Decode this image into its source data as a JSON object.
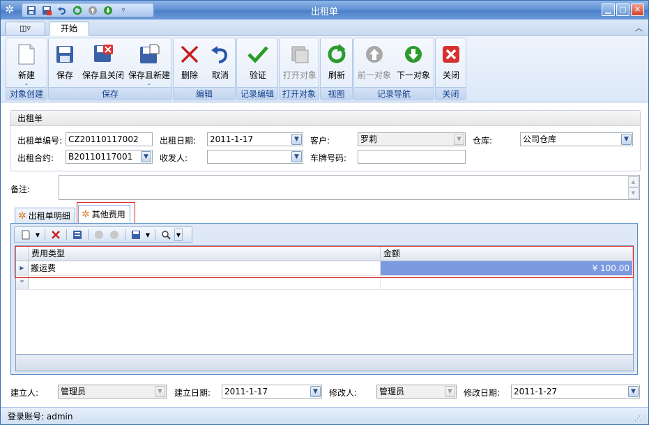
{
  "window": {
    "title": "出租单"
  },
  "qat": {
    "icons": [
      "save-icon",
      "save-close-icon",
      "undo-icon",
      "refresh-icon",
      "prev-icon",
      "next-icon"
    ]
  },
  "tabs": {
    "menu_label": "",
    "start_label": "开始"
  },
  "ribbon": {
    "groups": [
      {
        "label": "对象创建",
        "buttons": [
          {
            "label": "新建"
          }
        ]
      },
      {
        "label": "保存",
        "buttons": [
          {
            "label": "保存"
          },
          {
            "label": "保存且关闭"
          },
          {
            "label": "保存且新建"
          }
        ]
      },
      {
        "label": "编辑",
        "buttons": [
          {
            "label": "删除"
          },
          {
            "label": "取消"
          }
        ]
      },
      {
        "label": "记录编辑",
        "buttons": [
          {
            "label": "验证"
          }
        ]
      },
      {
        "label": "打开对象",
        "buttons": [
          {
            "label": "打开对象"
          }
        ]
      },
      {
        "label": "视图",
        "buttons": [
          {
            "label": "刷新"
          }
        ]
      },
      {
        "label": "记录导航",
        "buttons": [
          {
            "label": "前一对象"
          },
          {
            "label": "下一对象"
          }
        ]
      },
      {
        "label": "关闭",
        "buttons": [
          {
            "label": "关闭"
          }
        ]
      }
    ]
  },
  "form": {
    "section_title": "出租单",
    "order_no_label": "出租单编号:",
    "order_no": "CZ20110117002",
    "date_label": "出租日期:",
    "date": "2011-1-17",
    "customer_label": "客户:",
    "customer": "罗莉",
    "warehouse_label": "仓库:",
    "warehouse": "公司仓库",
    "contract_label": "出租合约:",
    "contract": "B20110117001",
    "receiver_label": "收发人:",
    "receiver": "",
    "plate_label": "车牌号码:",
    "plate": "",
    "remark_label": "备注:",
    "remark": ""
  },
  "detail": {
    "tab1": "出租单明细",
    "tab2": "其他费用",
    "columns": [
      "费用类型",
      "金额"
    ],
    "rows": [
      {
        "type": "搬运费",
        "amount": "¥ 100.00"
      }
    ],
    "new_row_marker": "*"
  },
  "footer": {
    "creator_label": "建立人:",
    "creator": "管理员",
    "create_date_label": "建立日期:",
    "create_date": "2011-1-17",
    "modifier_label": "修改人:",
    "modifier": "管理员",
    "modify_date_label": "修改日期:",
    "modify_date": "2011-1-27"
  },
  "status": {
    "text": "登录账号: admin"
  },
  "colors": {
    "accent": "#4b7fc8",
    "selection": "#7b9ae0",
    "highlight_box": "#dd2222"
  }
}
